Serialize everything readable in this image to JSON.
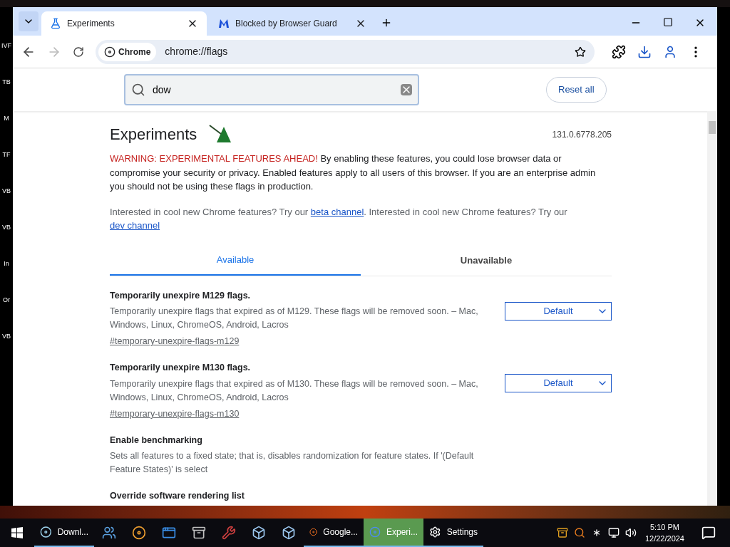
{
  "desktop_labels": [
    "IVF",
    "TB",
    "M",
    "TF",
    "VB",
    "VB",
    "In",
    "Or",
    "VB"
  ],
  "browser": {
    "tabs": [
      {
        "title": "Experiments",
        "selected": true
      },
      {
        "title": "Blocked by Browser Guard",
        "selected": false
      }
    ],
    "chip": "Chrome",
    "url": "chrome://flags"
  },
  "flags_page": {
    "search_value": "dow",
    "reset_button": "Reset all",
    "title": "Experiments",
    "version": "131.0.6778.205",
    "warning_lead": "WARNING: EXPERIMENTAL FEATURES AHEAD!",
    "warning_text": "By enabling these features, you could lose browser data or compromise your security or privacy. Enabled features apply to all users of this browser. If you are an enterprise admin you should not be using these flags in production.",
    "interest_parts": [
      {
        "kind": "text",
        "text": "Interested in cool new Chrome features? Try our "
      },
      {
        "kind": "link",
        "text": "beta channel"
      },
      {
        "kind": "text",
        "text": ". Interested in cool new Chrome features? Try our "
      },
      {
        "kind": "link",
        "text": "dev channel"
      }
    ],
    "tabs": [
      {
        "label": "Available",
        "selected": true
      },
      {
        "label": "Unavailable",
        "selected": false
      }
    ],
    "flags": [
      {
        "name": "Temporarily unexpire M129 flags.",
        "description": "Temporarily unexpire flags that expired as of M129. These flags will be removed soon. – Mac, Windows, Linux, ChromeOS, Android, Lacros",
        "anchor": "#temporary-unexpire-flags-m129",
        "value": "Default"
      },
      {
        "name": "Temporarily unexpire M130 flags.",
        "description": "Temporarily unexpire flags that expired as of M130. These flags will be removed soon. – Mac, Windows, Linux, ChromeOS, Android, Lacros",
        "anchor": "#temporary-unexpire-flags-m130",
        "value": "Default"
      },
      {
        "name": "Enable benchmarking",
        "description": "Sets all features to a fixed state; that is, disables randomization for feature states. If '(Default Feature States)' is select"
      },
      {
        "name": "Override software rendering list"
      }
    ]
  },
  "taskbar": {
    "items": [
      {
        "kind": "app",
        "label": "Downl...",
        "selected": false
      },
      {
        "kind": "icon"
      },
      {
        "kind": "icon"
      },
      {
        "kind": "icon"
      },
      {
        "kind": "icon"
      },
      {
        "kind": "icon"
      },
      {
        "kind": "icon"
      },
      {
        "kind": "icon"
      },
      {
        "kind": "app",
        "label": "Google...",
        "selected": false
      },
      {
        "kind": "app",
        "label": "Experi...",
        "selected": true
      },
      {
        "kind": "app",
        "label": "Settings",
        "selected": false
      }
    ],
    "time": "5:10 PM",
    "date": "12/22/2024"
  }
}
